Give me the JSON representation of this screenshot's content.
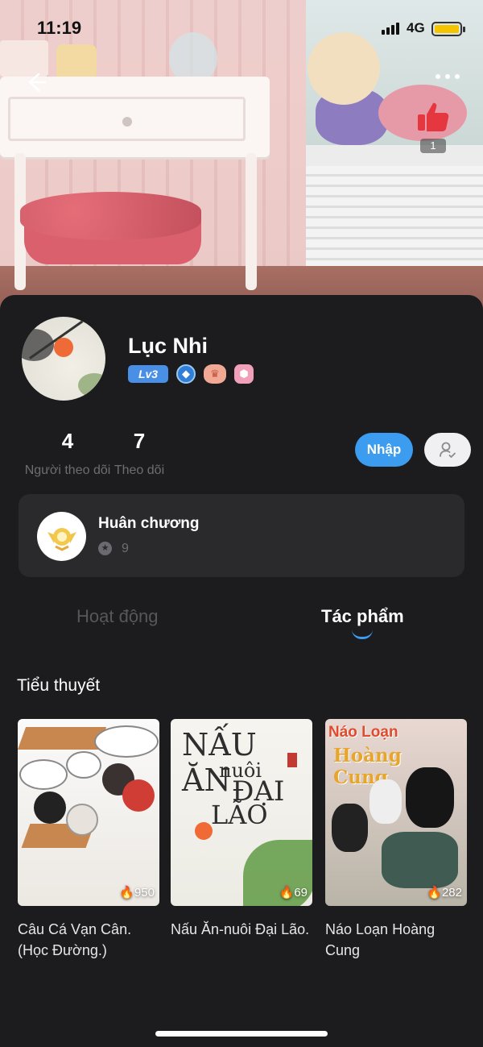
{
  "status_bar": {
    "time": "11:19",
    "network": "4G"
  },
  "header": {
    "like_count": "1"
  },
  "profile": {
    "name": "Lục Nhi",
    "level": "Lv3",
    "stats": [
      {
        "value": "4",
        "label": "Người theo dõi"
      },
      {
        "value": "7",
        "label": "Theo dõi"
      }
    ],
    "import_button": "Nhập",
    "follow_icon": "user-check-icon"
  },
  "medals": {
    "title": "Huân chương",
    "count": "9"
  },
  "tabs": [
    {
      "label": "Hoạt động",
      "active": false
    },
    {
      "label": "Tác phẩm",
      "active": true
    }
  ],
  "section": {
    "title": "Tiểu thuyết"
  },
  "books": [
    {
      "title": "Câu Cá Vạn Cân.(Học Đường.)",
      "heat": "950"
    },
    {
      "title": "Nấu Ăn-nuôi Đại Lão.",
      "heat": "69",
      "cover_text": [
        "NẤU ĂN",
        "nuôi",
        "ĐẠI",
        "LÃO"
      ]
    },
    {
      "title": "Náo Loạn Hoàng Cung",
      "heat": "282",
      "cover_text": [
        "Náo Loạn",
        "Hoàng Cung."
      ]
    }
  ],
  "colors": {
    "accent": "#3b9cf0",
    "background": "#1c1c1e",
    "card": "#2a2a2d",
    "like": "#e5373f"
  }
}
